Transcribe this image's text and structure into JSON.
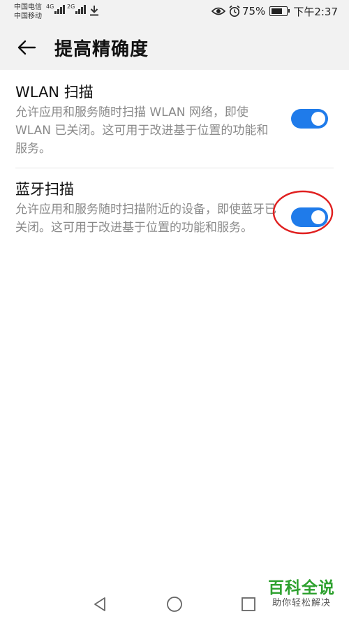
{
  "status_bar": {
    "carrier_1": "中国电信",
    "carrier_2": "中国移动",
    "network_1": "4G",
    "network_2": "2G",
    "battery_text": "75%",
    "battery_level": 0.75,
    "time": "下午2:37",
    "icons": [
      "eye-icon",
      "alarm-icon",
      "battery-icon",
      "download-icon"
    ]
  },
  "header": {
    "title": "提高精确度"
  },
  "settings": [
    {
      "title": "WLAN 扫描",
      "description": "允许应用和服务随时扫描 WLAN 网络，即使 WLAN 已关闭。这可用于改进基于位置的功能和服务。",
      "enabled": true
    },
    {
      "title": "蓝牙扫描",
      "description": "允许应用和服务随时扫描附近的设备，即使蓝牙已关闭。这可用于改进基于位置的功能和服务。",
      "enabled": true
    }
  ],
  "nav": {
    "icons": [
      "back-triangle-icon",
      "home-circle-icon",
      "recents-square-icon"
    ]
  },
  "watermark": {
    "title": "百科全说",
    "subtitle": "助你轻松解决"
  },
  "colors": {
    "toggle_on": "#1f7bea",
    "annotation": "#e02020",
    "watermark": "#2ea12f"
  }
}
